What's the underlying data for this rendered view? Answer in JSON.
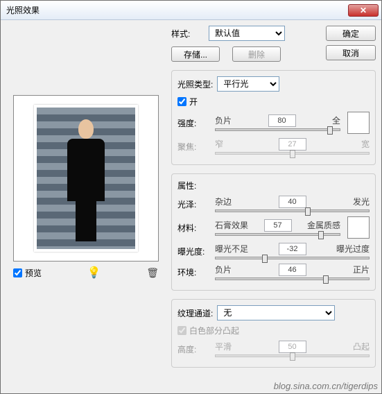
{
  "window": {
    "title": "光照效果"
  },
  "buttons": {
    "ok": "确定",
    "cancel": "取消",
    "save": "存储...",
    "delete": "删除"
  },
  "style": {
    "label": "样式:",
    "value": "默认值"
  },
  "light_type": {
    "legend": "光照类型:",
    "value": "平行光",
    "on_label": "开",
    "on_checked": true,
    "intensity": {
      "label": "强度:",
      "left": "负片",
      "right": "全",
      "value": "80",
      "pos": 92
    },
    "focus": {
      "label": "聚焦:",
      "left": "窄",
      "right": "宽",
      "value": "27",
      "pos": 50
    }
  },
  "properties": {
    "legend": "属性:",
    "gloss": {
      "label": "光泽:",
      "left": "杂边",
      "right": "发光",
      "value": "40",
      "pos": 60
    },
    "material": {
      "label": "材料:",
      "left": "石膏效果",
      "right": "金属质感",
      "value": "57",
      "pos": 85
    },
    "exposure": {
      "label": "曝光度:",
      "left": "曝光不足",
      "right": "曝光过度",
      "value": "-32",
      "pos": 32
    },
    "ambience": {
      "label": "环境:",
      "left": "负片",
      "right": "正片",
      "value": "46",
      "pos": 72
    }
  },
  "texture": {
    "legend": "纹理通道:",
    "value": "无",
    "white_label": "白色部分凸起",
    "white_checked": true,
    "height": {
      "label": "高度:",
      "left": "平滑",
      "right": "凸起",
      "value": "50",
      "pos": 50
    }
  },
  "preview": {
    "label": "预览",
    "checked": true
  },
  "watermark": "blog.sina.com.cn/tigerdips"
}
